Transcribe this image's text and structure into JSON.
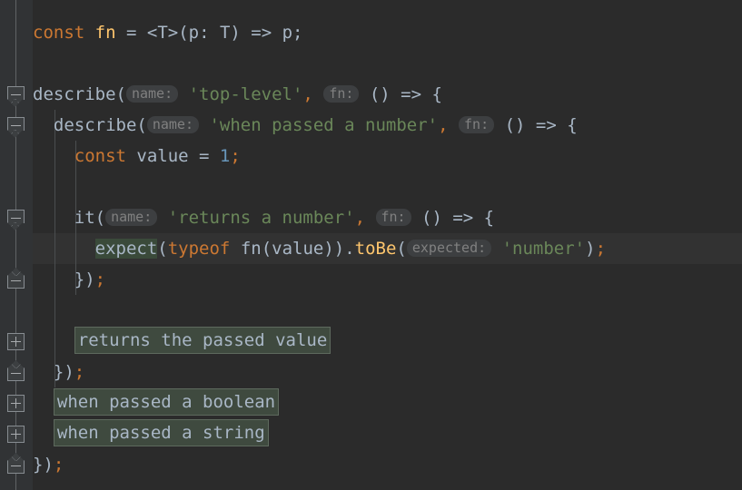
{
  "editor": {
    "language": "TypeScript",
    "theme": "Darcula",
    "background_color": "#2B2B2B",
    "gutter_color": "#313335",
    "colors": {
      "keyword": "#CC7832",
      "function_name": "#FFC66D",
      "string": "#6A8759",
      "number": "#6897BB",
      "default_text": "#A9B7C6",
      "inlay_hint_bg": "#3D3F41",
      "inlay_hint_text": "#808080",
      "fold_placeholder_bg": "#3F4A3F",
      "usage_highlight_bg": "#3A4A3A",
      "caret_row_bg": "#323232"
    },
    "lines": [
      {
        "id": "line-1",
        "fold": null,
        "tokens": [
          {
            "t": "const",
            "c": "kw"
          },
          {
            "t": " ",
            "c": "op"
          },
          {
            "t": "fn",
            "c": "fnm"
          },
          {
            "t": " = ",
            "c": "op"
          },
          {
            "t": "<T>(p: T) => p;",
            "c": "def"
          }
        ]
      },
      {
        "id": "line-2",
        "fold": null,
        "tokens": []
      },
      {
        "id": "line-3",
        "fold": "collapse-pointed-down",
        "tokens": [
          {
            "t": "describe(",
            "c": "def"
          },
          {
            "t": "name:",
            "c": "hint"
          },
          {
            "t": " ",
            "c": "def"
          },
          {
            "t": "'top-level'",
            "c": "str"
          },
          {
            "t": ",",
            "c": "semi"
          },
          {
            "t": " ",
            "c": "def"
          },
          {
            "t": "fn:",
            "c": "hint"
          },
          {
            "t": " () => {",
            "c": "def"
          }
        ]
      },
      {
        "id": "line-4",
        "fold": "collapse-pointed-down",
        "tokens": [
          {
            "t": "  describe(",
            "c": "def"
          },
          {
            "t": "name:",
            "c": "hint"
          },
          {
            "t": " ",
            "c": "def"
          },
          {
            "t": "'when passed a number'",
            "c": "str"
          },
          {
            "t": ",",
            "c": "semi"
          },
          {
            "t": " ",
            "c": "def"
          },
          {
            "t": "fn:",
            "c": "hint"
          },
          {
            "t": " () => {",
            "c": "def"
          }
        ]
      },
      {
        "id": "line-5",
        "fold": null,
        "tokens": [
          {
            "t": "    ",
            "c": "def"
          },
          {
            "t": "const",
            "c": "kw"
          },
          {
            "t": " value = ",
            "c": "def"
          },
          {
            "t": "1",
            "c": "num"
          },
          {
            "t": ";",
            "c": "semi"
          }
        ]
      },
      {
        "id": "line-6",
        "fold": null,
        "tokens": []
      },
      {
        "id": "line-7",
        "fold": "collapse-pointed-down",
        "tokens": [
          {
            "t": "    it(",
            "c": "def"
          },
          {
            "t": "name:",
            "c": "hint"
          },
          {
            "t": " ",
            "c": "def"
          },
          {
            "t": "'returns a number'",
            "c": "str"
          },
          {
            "t": ",",
            "c": "semi"
          },
          {
            "t": " ",
            "c": "def"
          },
          {
            "t": "fn:",
            "c": "hint"
          },
          {
            "t": " () => {",
            "c": "def"
          }
        ]
      },
      {
        "id": "line-8",
        "fold": null,
        "highlight_row": true,
        "tokens": [
          {
            "t": "      ",
            "c": "def"
          },
          {
            "t": "expect",
            "c": "usage"
          },
          {
            "t": "(",
            "c": "def"
          },
          {
            "t": "typeof",
            "c": "kw"
          },
          {
            "t": " fn(value)).",
            "c": "def"
          },
          {
            "t": "toBe",
            "c": "meth"
          },
          {
            "t": "(",
            "c": "def"
          },
          {
            "t": "expected:",
            "c": "hint"
          },
          {
            "t": " ",
            "c": "def"
          },
          {
            "t": "'number'",
            "c": "str"
          },
          {
            "t": ")",
            "c": "def"
          },
          {
            "t": ";",
            "c": "semi"
          }
        ]
      },
      {
        "id": "line-9",
        "fold": "collapse-pointed-up",
        "tokens": [
          {
            "t": "    })",
            "c": "def"
          },
          {
            "t": ";",
            "c": "semi"
          }
        ]
      },
      {
        "id": "line-10",
        "fold": null,
        "tokens": []
      },
      {
        "id": "line-11",
        "fold": "expand",
        "tokens": [
          {
            "t": "    ",
            "c": "def"
          },
          {
            "t": "returns the passed value",
            "c": "folded"
          }
        ]
      },
      {
        "id": "line-12",
        "fold": "collapse-pointed-up",
        "tokens": [
          {
            "t": "  })",
            "c": "def"
          },
          {
            "t": ";",
            "c": "semi"
          }
        ]
      },
      {
        "id": "line-13",
        "fold": "expand",
        "tokens": [
          {
            "t": "  ",
            "c": "def"
          },
          {
            "t": "when passed a boolean",
            "c": "folded"
          }
        ]
      },
      {
        "id": "line-14",
        "fold": "expand",
        "tokens": [
          {
            "t": "  ",
            "c": "def"
          },
          {
            "t": "when passed a string",
            "c": "folded"
          }
        ]
      },
      {
        "id": "line-15",
        "fold": "collapse-pointed-up",
        "tokens": [
          {
            "t": "})",
            "c": "def"
          },
          {
            "t": ";",
            "c": "semi"
          }
        ]
      }
    ]
  }
}
